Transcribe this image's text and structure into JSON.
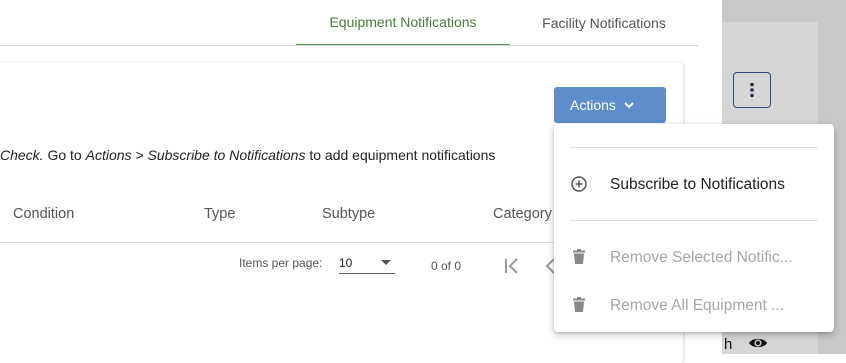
{
  "tabs": [
    {
      "label": "Equipment Notifications",
      "active": true
    },
    {
      "label": "Facility Notifications",
      "active": false
    }
  ],
  "actions_button": {
    "label": "Actions"
  },
  "info": {
    "pre": "Check.",
    "mid1": " Go to ",
    "path1": "Actions",
    "sep": " > ",
    "path2": "Subscribe to Notifications",
    "post": " to add equipment notifications"
  },
  "table": {
    "columns": [
      "Condition",
      "Type",
      "Subtype",
      "Category"
    ]
  },
  "paginator": {
    "items_per_page_label": "Items per page:",
    "items_per_page_value": "10",
    "range_label": "0 of 0"
  },
  "menu": {
    "items": [
      {
        "label": "Subscribe to Notifications",
        "icon": "plus-circle-icon",
        "disabled": false
      },
      {
        "label": "Remove Selected Notific...",
        "icon": "trash-icon",
        "disabled": true
      },
      {
        "label": "Remove All Equipment ...",
        "icon": "trash-icon",
        "disabled": true
      }
    ]
  },
  "side": {
    "text": "h"
  },
  "colors": {
    "accent_tab": "#4f9a54",
    "actions_bg": "#5f8dcb",
    "backdrop": "#c9c9c9"
  }
}
